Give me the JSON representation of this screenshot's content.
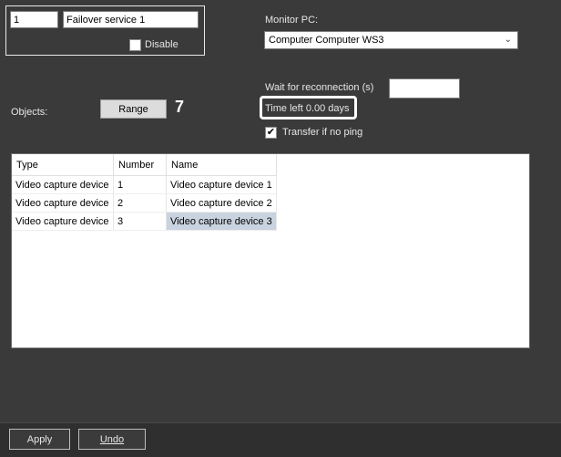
{
  "service": {
    "id": "1",
    "name": "Failover service 1",
    "disable_label": "Disable",
    "disable_checked": false
  },
  "monitor": {
    "label": "Monitor PC:",
    "selected": "Computer Computer WS3"
  },
  "reconnect": {
    "wait_label": "Wait for reconnection (s)",
    "wait_value": "",
    "time_left": "Time left 0.00 days",
    "transfer_label": "Transfer if no ping",
    "transfer_checked": true
  },
  "objects": {
    "label": "Objects:",
    "range_button": "Range",
    "callout": "7"
  },
  "table": {
    "headers": [
      "Type",
      "Number",
      "Name"
    ],
    "rows": [
      [
        "Video capture device",
        "1",
        "Video capture device 1"
      ],
      [
        "Video capture device",
        "2",
        "Video capture device 2"
      ],
      [
        "Video capture device",
        "3",
        "Video capture device 3"
      ]
    ],
    "selected_row": 2
  },
  "footer": {
    "apply": "Apply",
    "undo": "Undo"
  }
}
